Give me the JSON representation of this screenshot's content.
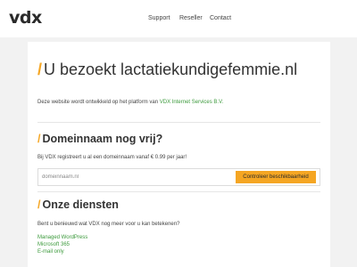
{
  "header": {
    "logo_text": "vdx",
    "nav": {
      "support": "Support",
      "reseller": "Reseller",
      "contact": "Contact"
    }
  },
  "main": {
    "title_slash": "/",
    "title": "U bezoekt lactatiekundigefemmie.nl",
    "intro_text": "Deze website wordt ontwikkeld op het platform van ",
    "intro_link": "VDX Internet Services B.V."
  },
  "domain_section": {
    "heading_slash": "/",
    "heading": "Domeinnaam nog vrij?",
    "description": "Bij VDX registreert u al een domeinnaam vanaf € 0.99 per jaar!",
    "search_placeholder": "domeinnaam.nl",
    "search_button": "Controleer beschikbaarheid"
  },
  "services_section": {
    "heading_slash": "/",
    "heading": "Onze diensten",
    "description": "Bent u benieuwd wat VDX nog meer voor u kan betekenen?",
    "items": [
      "Managed WordPress",
      "Microsoft 365",
      "E-mail only"
    ]
  },
  "colors": {
    "accent": "#f5a623",
    "link": "#3c9a3c",
    "background": "#f2f2f2"
  }
}
